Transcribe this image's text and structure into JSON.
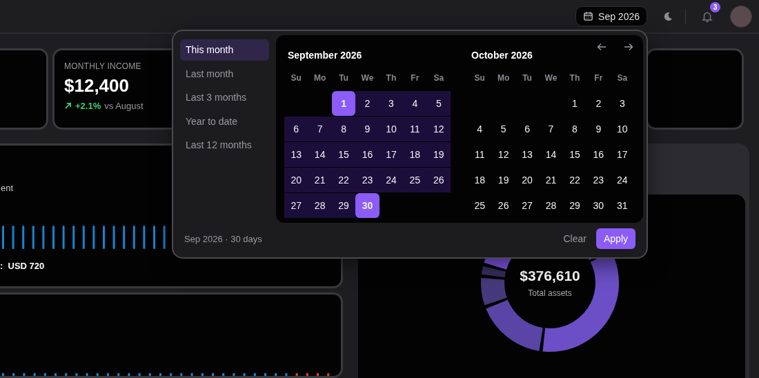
{
  "header": {
    "date_button": "Sep 2026",
    "notification_badge": "3"
  },
  "cards": [
    {
      "kind": "empty"
    },
    {
      "kind": "stat",
      "label": "MONTHLY INCOME",
      "value": "$12,400",
      "change": "+2.1%",
      "change_note": "vs August"
    },
    {
      "kind": "empty"
    },
    {
      "kind": "empty"
    }
  ],
  "spending_panel": {
    "label": "ent",
    "summary": ":  USD 720"
  },
  "assets_panel": {
    "total": "$376,610",
    "caption": "Total assets"
  },
  "date_picker": {
    "presets": [
      {
        "label": "This month",
        "selected": true
      },
      {
        "label": "Last month",
        "selected": false
      },
      {
        "label": "Last 3 months",
        "selected": false
      },
      {
        "label": "Year to date",
        "selected": false
      },
      {
        "label": "Last 12 months",
        "selected": false
      }
    ],
    "months": [
      {
        "title": "September 2026",
        "weekdays": [
          "Su",
          "Mo",
          "Tu",
          "We",
          "Th",
          "Fr",
          "Sa"
        ],
        "weeks": [
          [
            {
              "kind": "blank"
            },
            {
              "kind": "blank"
            },
            {
              "kind": "day",
              "label": "1",
              "in_range": true,
              "selected": true
            },
            {
              "kind": "day",
              "label": "2",
              "in_range": true,
              "selected": false
            },
            {
              "kind": "day",
              "label": "3",
              "in_range": true,
              "selected": false
            },
            {
              "kind": "day",
              "label": "4",
              "in_range": true,
              "selected": false
            },
            {
              "kind": "day",
              "label": "5",
              "in_range": true,
              "selected": false
            }
          ],
          [
            {
              "kind": "day",
              "label": "6",
              "in_range": true,
              "selected": false
            },
            {
              "kind": "day",
              "label": "7",
              "in_range": true,
              "selected": false
            },
            {
              "kind": "day",
              "label": "8",
              "in_range": true,
              "selected": false
            },
            {
              "kind": "day",
              "label": "9",
              "in_range": true,
              "selected": false
            },
            {
              "kind": "day",
              "label": "10",
              "in_range": true,
              "selected": false
            },
            {
              "kind": "day",
              "label": "11",
              "in_range": true,
              "selected": false
            },
            {
              "kind": "day",
              "label": "12",
              "in_range": true,
              "selected": false
            }
          ],
          [
            {
              "kind": "day",
              "label": "13",
              "in_range": true,
              "selected": false
            },
            {
              "kind": "day",
              "label": "14",
              "in_range": true,
              "selected": false
            },
            {
              "kind": "day",
              "label": "15",
              "in_range": true,
              "selected": false
            },
            {
              "kind": "day",
              "label": "16",
              "in_range": true,
              "selected": false
            },
            {
              "kind": "day",
              "label": "17",
              "in_range": true,
              "selected": false
            },
            {
              "kind": "day",
              "label": "18",
              "in_range": true,
              "selected": false
            },
            {
              "kind": "day",
              "label": "19",
              "in_range": true,
              "selected": false
            }
          ],
          [
            {
              "kind": "day",
              "label": "20",
              "in_range": true,
              "selected": false
            },
            {
              "kind": "day",
              "label": "21",
              "in_range": true,
              "selected": false
            },
            {
              "kind": "day",
              "label": "22",
              "in_range": true,
              "selected": false
            },
            {
              "kind": "day",
              "label": "23",
              "in_range": true,
              "selected": false
            },
            {
              "kind": "day",
              "label": "24",
              "in_range": true,
              "selected": false
            },
            {
              "kind": "day",
              "label": "25",
              "in_range": true,
              "selected": false
            },
            {
              "kind": "day",
              "label": "26",
              "in_range": true,
              "selected": false
            }
          ],
          [
            {
              "kind": "day",
              "label": "27",
              "in_range": true,
              "selected": false
            },
            {
              "kind": "day",
              "label": "28",
              "in_range": true,
              "selected": false
            },
            {
              "kind": "day",
              "label": "29",
              "in_range": true,
              "selected": false
            },
            {
              "kind": "day",
              "label": "30",
              "in_range": true,
              "selected": true
            },
            {
              "kind": "blank"
            },
            {
              "kind": "blank"
            },
            {
              "kind": "blank"
            }
          ]
        ]
      },
      {
        "title": "October 2026",
        "weekdays": [
          "Su",
          "Mo",
          "Tu",
          "We",
          "Th",
          "Fr",
          "Sa"
        ],
        "weeks": [
          [
            {
              "kind": "blank"
            },
            {
              "kind": "blank"
            },
            {
              "kind": "blank"
            },
            {
              "kind": "blank"
            },
            {
              "kind": "day",
              "label": "1",
              "in_range": false,
              "selected": false
            },
            {
              "kind": "day",
              "label": "2",
              "in_range": false,
              "selected": false
            },
            {
              "kind": "day",
              "label": "3",
              "in_range": false,
              "selected": false
            }
          ],
          [
            {
              "kind": "day",
              "label": "4",
              "in_range": false,
              "selected": false
            },
            {
              "kind": "day",
              "label": "5",
              "in_range": false,
              "selected": false
            },
            {
              "kind": "day",
              "label": "6",
              "in_range": false,
              "selected": false
            },
            {
              "kind": "day",
              "label": "7",
              "in_range": false,
              "selected": false
            },
            {
              "kind": "day",
              "label": "8",
              "in_range": false,
              "selected": false
            },
            {
              "kind": "day",
              "label": "9",
              "in_range": false,
              "selected": false
            },
            {
              "kind": "day",
              "label": "10",
              "in_range": false,
              "selected": false
            }
          ],
          [
            {
              "kind": "day",
              "label": "11",
              "in_range": false,
              "selected": false
            },
            {
              "kind": "day",
              "label": "12",
              "in_range": false,
              "selected": false
            },
            {
              "kind": "day",
              "label": "13",
              "in_range": false,
              "selected": false
            },
            {
              "kind": "day",
              "label": "14",
              "in_range": false,
              "selected": false
            },
            {
              "kind": "day",
              "label": "15",
              "in_range": false,
              "selected": false
            },
            {
              "kind": "day",
              "label": "16",
              "in_range": false,
              "selected": false
            },
            {
              "kind": "day",
              "label": "17",
              "in_range": false,
              "selected": false
            }
          ],
          [
            {
              "kind": "day",
              "label": "18",
              "in_range": false,
              "selected": false
            },
            {
              "kind": "day",
              "label": "19",
              "in_range": false,
              "selected": false
            },
            {
              "kind": "day",
              "label": "20",
              "in_range": false,
              "selected": false
            },
            {
              "kind": "day",
              "label": "21",
              "in_range": false,
              "selected": false
            },
            {
              "kind": "day",
              "label": "22",
              "in_range": false,
              "selected": false
            },
            {
              "kind": "day",
              "label": "23",
              "in_range": false,
              "selected": false
            },
            {
              "kind": "day",
              "label": "24",
              "in_range": false,
              "selected": false
            }
          ],
          [
            {
              "kind": "day",
              "label": "25",
              "in_range": false,
              "selected": false
            },
            {
              "kind": "day",
              "label": "26",
              "in_range": false,
              "selected": false
            },
            {
              "kind": "day",
              "label": "27",
              "in_range": false,
              "selected": false
            },
            {
              "kind": "day",
              "label": "28",
              "in_range": false,
              "selected": false
            },
            {
              "kind": "day",
              "label": "29",
              "in_range": false,
              "selected": false
            },
            {
              "kind": "day",
              "label": "30",
              "in_range": false,
              "selected": false
            },
            {
              "kind": "day",
              "label": "31",
              "in_range": false,
              "selected": false
            }
          ]
        ]
      }
    ],
    "summary": "Sep 2026 · 30 days",
    "clear": "Clear",
    "apply": "Apply"
  }
}
